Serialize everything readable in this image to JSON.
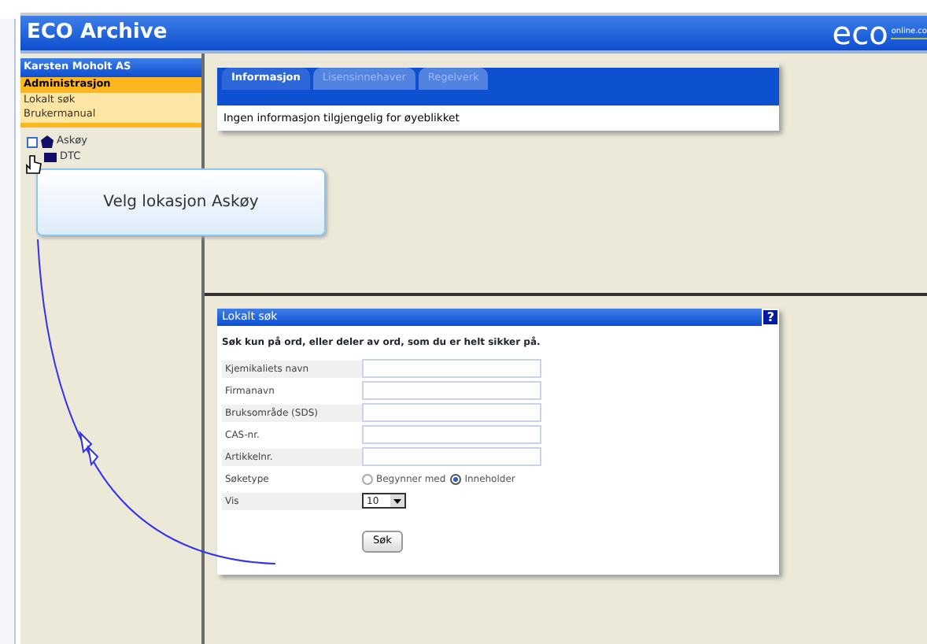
{
  "window": {
    "title": "ECO Archive",
    "logo": "eco",
    "logo_suffix": "online.co"
  },
  "sidebar": {
    "company": "Karsten Moholt AS",
    "items": [
      {
        "label": "Administrasjon",
        "selected": true
      },
      {
        "label": "Lokalt søk",
        "selected": false
      },
      {
        "label": "Brukermanual",
        "selected": false
      }
    ],
    "tree": [
      {
        "label": "Askøy",
        "kind": "site"
      },
      {
        "label": "DTC",
        "kind": "flag"
      }
    ]
  },
  "tooltip": "Velg lokasjon Askøy",
  "info_panel": {
    "tabs": [
      {
        "label": "Informasjon",
        "selected": true
      },
      {
        "label": "Lisensinnehaver",
        "selected": false
      },
      {
        "label": "Regelverk",
        "selected": false
      }
    ],
    "message": "Ingen informasjon tilgjengelig for øyeblikket"
  },
  "search_panel": {
    "title": "Lokalt søk",
    "help": "?",
    "intro": "Søk kun på ord, eller deler av ord, som du er helt sikker på.",
    "fields": [
      {
        "label": "Kjemikaliets navn",
        "kind": "text"
      },
      {
        "label": "Firmanavn",
        "kind": "text"
      },
      {
        "label": "Bruksområde (SDS)",
        "kind": "text"
      },
      {
        "label": "CAS-nr.",
        "kind": "text"
      },
      {
        "label": "Artikkelnr.",
        "kind": "text"
      },
      {
        "label": "Søketype",
        "kind": "radio",
        "options": [
          {
            "label": "Begynner med",
            "selected": false
          },
          {
            "label": "Inneholder",
            "selected": true
          }
        ]
      },
      {
        "label": "Vis",
        "kind": "select",
        "value": "10"
      }
    ],
    "button": "Søk"
  }
}
